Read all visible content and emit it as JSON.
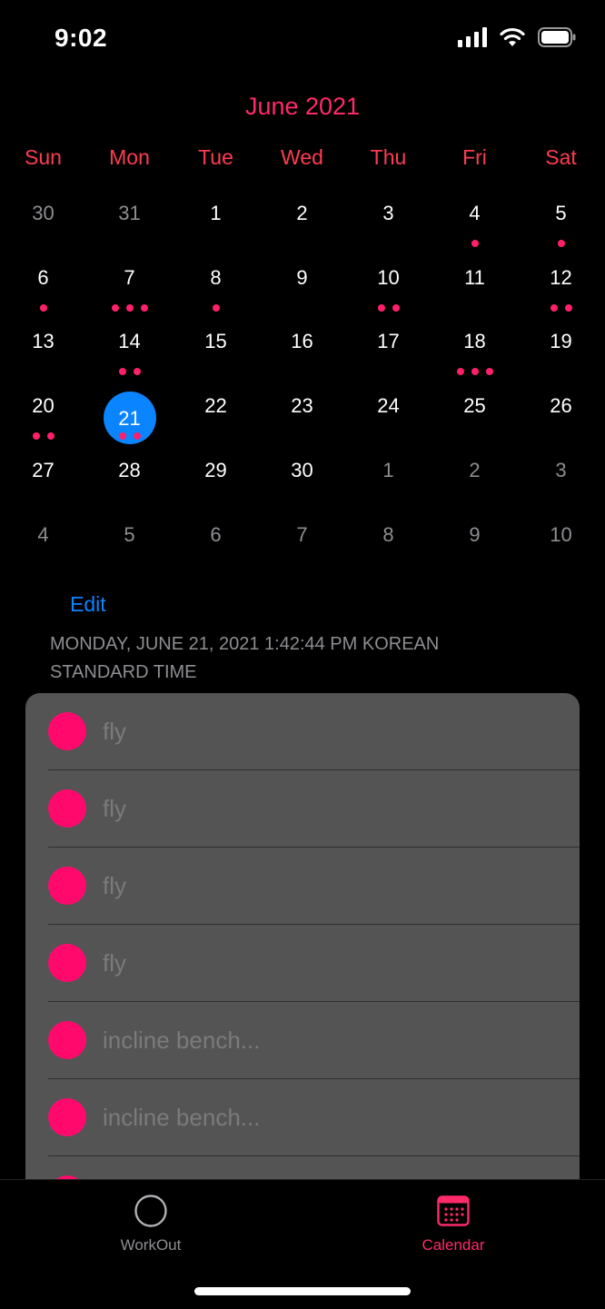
{
  "status_bar": {
    "time": "9:02",
    "icons": [
      "signal-icon",
      "wifi-icon",
      "battery-icon"
    ]
  },
  "calendar": {
    "month_title": "June 2021",
    "weekdays": [
      "Sun",
      "Mon",
      "Tue",
      "Wed",
      "Thu",
      "Fri",
      "Sat"
    ],
    "accent_color": "#ff2a6a",
    "selected_color": "#0a84ff",
    "weeks": [
      [
        {
          "d": "30",
          "out": true,
          "dots": 0
        },
        {
          "d": "31",
          "out": true,
          "dots": 0
        },
        {
          "d": "1",
          "dots": 0
        },
        {
          "d": "2",
          "dots": 0
        },
        {
          "d": "3",
          "dots": 0
        },
        {
          "d": "4",
          "dots": 1
        },
        {
          "d": "5",
          "dots": 1
        }
      ],
      [
        {
          "d": "6",
          "dots": 1
        },
        {
          "d": "7",
          "dots": 3
        },
        {
          "d": "8",
          "dots": 1
        },
        {
          "d": "9",
          "dots": 0
        },
        {
          "d": "10",
          "dots": 2
        },
        {
          "d": "11",
          "dots": 0
        },
        {
          "d": "12",
          "dots": 2
        }
      ],
      [
        {
          "d": "13",
          "dots": 0
        },
        {
          "d": "14",
          "dots": 2
        },
        {
          "d": "15",
          "dots": 0
        },
        {
          "d": "16",
          "dots": 0
        },
        {
          "d": "17",
          "dots": 0
        },
        {
          "d": "18",
          "dots": 3
        },
        {
          "d": "19",
          "dots": 0
        }
      ],
      [
        {
          "d": "20",
          "dots": 2
        },
        {
          "d": "21",
          "dots": 2,
          "selected": true
        },
        {
          "d": "22",
          "dots": 0
        },
        {
          "d": "23",
          "dots": 0
        },
        {
          "d": "24",
          "dots": 0
        },
        {
          "d": "25",
          "dots": 0
        },
        {
          "d": "26",
          "dots": 0
        }
      ],
      [
        {
          "d": "27",
          "dots": 0
        },
        {
          "d": "28",
          "dots": 0
        },
        {
          "d": "29",
          "dots": 0
        },
        {
          "d": "30",
          "dots": 0
        },
        {
          "d": "1",
          "out": true,
          "dots": 0
        },
        {
          "d": "2",
          "out": true,
          "dots": 0
        },
        {
          "d": "3",
          "out": true,
          "dots": 0
        }
      ],
      [
        {
          "d": "4",
          "out": true,
          "dots": 0
        },
        {
          "d": "5",
          "out": true,
          "dots": 0
        },
        {
          "d": "6",
          "out": true,
          "dots": 0
        },
        {
          "d": "7",
          "out": true,
          "dots": 0
        },
        {
          "d": "8",
          "out": true,
          "dots": 0
        },
        {
          "d": "9",
          "out": true,
          "dots": 0
        },
        {
          "d": "10",
          "out": true,
          "dots": 0
        }
      ]
    ]
  },
  "list": {
    "edit_label": "Edit",
    "date_header": "MONDAY, JUNE 21, 2021 1:42:44 PM KOREAN STANDARD TIME",
    "items": [
      "fly",
      "fly",
      "fly",
      "fly",
      "incline bench...",
      "incline bench...",
      ""
    ]
  },
  "tab_bar": {
    "tabs": [
      {
        "label": "WorkOut",
        "icon": "circle-icon",
        "active": false
      },
      {
        "label": "Calendar",
        "icon": "calendar-icon",
        "active": true
      }
    ]
  }
}
